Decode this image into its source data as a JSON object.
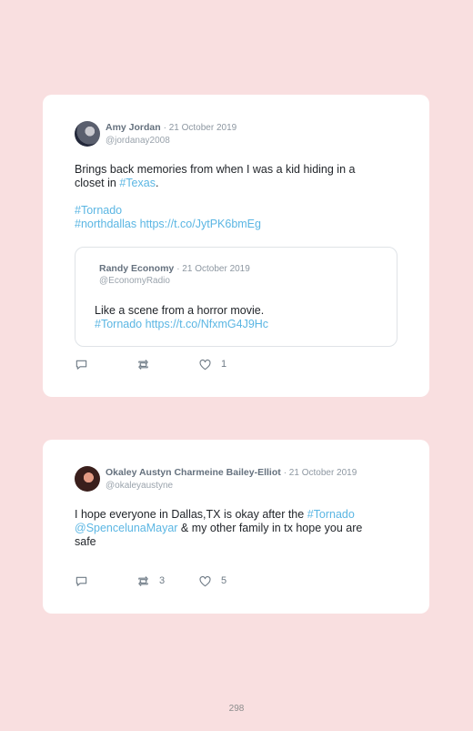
{
  "tweets": [
    {
      "author": "Amy Jordan",
      "date": "· 21 October 2019",
      "handle": "@jordanay2008",
      "lines": [
        [
          {
            "t": "Brings back memories from when I was a kid hiding in a"
          }
        ],
        [
          {
            "t": "closet in "
          },
          {
            "t": "#Texas",
            "link": true
          },
          {
            "t": "."
          }
        ],
        [
          {
            "t": " "
          }
        ],
        [
          {
            "t": "#Tornado",
            "link": true
          }
        ],
        [
          {
            "t": "#northdallas https://t.co/JytPK6bmEg",
            "link": true
          }
        ]
      ],
      "quote": {
        "author": "Randy Economy",
        "date": "· 21 October 2019",
        "handle": "@EconomyRadio",
        "lines": [
          [
            {
              "t": "Like a scene from a horror movie."
            }
          ],
          [
            {
              "t": "#Tornado https://t.co/NfxmG4J9Hc",
              "link": true
            }
          ]
        ]
      },
      "actions": {
        "reply": "",
        "retweet": "",
        "like": "1"
      }
    },
    {
      "author": "Okaley Austyn Charmeine Bailey-Elliot",
      "date": "· 21 October 2019",
      "handle": "@okaleyaustyne",
      "lines": [
        [
          {
            "t": "I hope everyone in Dallas,TX is okay after the "
          },
          {
            "t": "#Tornado",
            "link": true
          }
        ],
        [
          {
            "t": "@SpencelunaMayar",
            "link": true
          },
          {
            "t": " & my other family in tx hope you are"
          }
        ],
        [
          {
            "t": "safe"
          }
        ]
      ],
      "actions": {
        "reply": "",
        "retweet": "3",
        "like": "5"
      }
    }
  ],
  "page_number": "298",
  "colors": {
    "background": "#f9dfe0",
    "link": "#5bb6e3",
    "meta": "#65717e"
  },
  "icons": {
    "reply": "speech-bubble-icon",
    "retweet": "retweet-icon",
    "like": "heart-icon"
  }
}
